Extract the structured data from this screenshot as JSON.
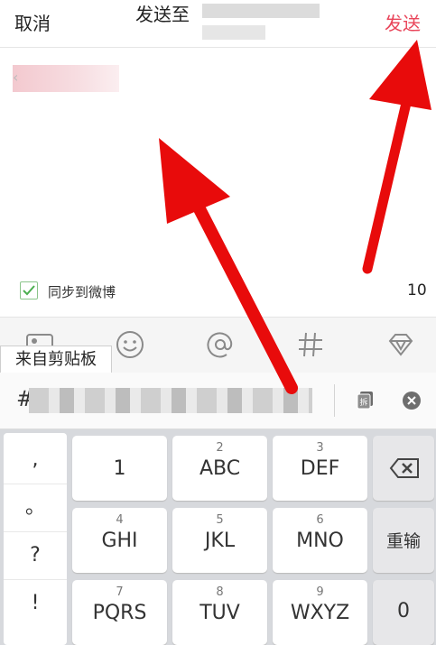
{
  "header": {
    "cancel_label": "取消",
    "title": "发送至",
    "send_label": "发送"
  },
  "compose": {
    "quote_prefix": "‹"
  },
  "sync": {
    "label": "同步到微博",
    "checked": true,
    "char_count": "10"
  },
  "toolbar": {
    "icons": [
      "image-icon",
      "emoji-icon",
      "mention-icon",
      "hashtag-icon",
      "diamond-icon"
    ]
  },
  "clipboard": {
    "label": "来自剪贴板",
    "prefix": "#"
  },
  "keyboard": {
    "punctuation": [
      ",",
      "。",
      "?",
      "!"
    ],
    "keys": [
      {
        "num": "",
        "label": "1"
      },
      {
        "num": "2",
        "label": "ABC"
      },
      {
        "num": "3",
        "label": "DEF"
      },
      {
        "num": "4",
        "label": "GHI"
      },
      {
        "num": "5",
        "label": "JKL"
      },
      {
        "num": "6",
        "label": "MNO"
      },
      {
        "num": "7",
        "label": "PQRS"
      },
      {
        "num": "8",
        "label": "TUV"
      },
      {
        "num": "9",
        "label": "WXYZ"
      }
    ],
    "reenter_label": "重输",
    "zero_label": "0"
  },
  "colors": {
    "accent": "#e9455a",
    "arrow": "#e80b0b",
    "check": "#4caf50"
  }
}
